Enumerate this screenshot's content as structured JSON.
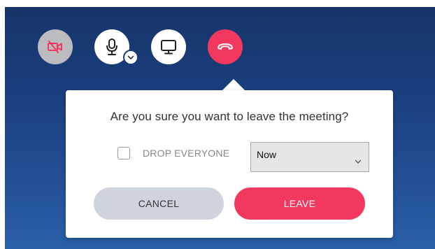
{
  "toolbar": {
    "video_icon": "video-off-icon",
    "mic_icon": "microphone-icon",
    "mic_menu_icon": "chevron-down-icon",
    "screen_icon": "monitor-icon",
    "leave_icon": "hang-up-icon"
  },
  "dialog": {
    "question": "Are you sure you want to leave the meeting?",
    "drop_everyone_label": "DROP EVERYONE",
    "drop_everyone_checked": false,
    "timing_select": {
      "selected": "Now"
    },
    "cancel_label": "CANCEL",
    "leave_label": "LEAVE"
  },
  "colors": {
    "accent": "#f2385f",
    "background_top": "#163468",
    "background_bottom": "#2a5fa8",
    "cancel_bg": "#cfd4dc",
    "video_off_bg": "#bcbcc0"
  }
}
